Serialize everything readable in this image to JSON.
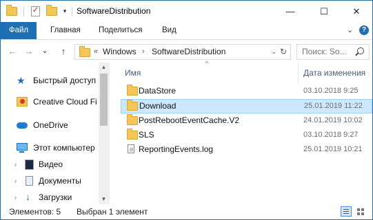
{
  "window": {
    "title": "SoftwareDistribution",
    "quick_access_dropdown": "▾",
    "minimize": "—",
    "maximize": "☐",
    "close": "✕",
    "accent": "#1f6fb5"
  },
  "ribbon": {
    "tabs": [
      "Файл",
      "Главная",
      "Поделиться",
      "Вид"
    ],
    "expand": "⌄",
    "help": "?"
  },
  "nav": {
    "back": "←",
    "forward": "→",
    "recent": "⌄",
    "up": "↑",
    "breadcrumb_overflow": "«",
    "breadcrumb": [
      "Windows",
      "SoftwareDistribution"
    ],
    "breadcrumb_sep": "›",
    "address_dropdown": "⌄",
    "refresh": "↻",
    "search_placeholder": "Поиск: So..."
  },
  "sidebar": {
    "items": [
      {
        "label": "Быстрый доступ",
        "icon": "star-icon"
      },
      {
        "label": "Creative Cloud Files",
        "icon": "creative-cloud-folder-icon"
      },
      {
        "label": "OneDrive",
        "icon": "onedrive-cloud-icon"
      },
      {
        "label": "Этот компьютер",
        "icon": "computer-icon"
      },
      {
        "label": "Видео",
        "icon": "video-icon"
      },
      {
        "label": "Документы",
        "icon": "documents-icon"
      },
      {
        "label": "Загрузки",
        "icon": "downloads-icon"
      }
    ],
    "expander": "›",
    "scroll_up": "▲",
    "scroll_down": "▼"
  },
  "columns": {
    "name": "Имя",
    "date_modified": "Дата изменения",
    "sort_indicator": "^"
  },
  "files": [
    {
      "name": "DataStore",
      "date": "03.10.2018 9:25",
      "type": "folder",
      "selected": false
    },
    {
      "name": "Download",
      "date": "25.01.2019 11:22",
      "type": "folder",
      "selected": true
    },
    {
      "name": "PostRebootEventCache.V2",
      "date": "24.01.2019 10:02",
      "type": "folder",
      "selected": false
    },
    {
      "name": "SLS",
      "date": "03.10.2018 9:27",
      "type": "folder",
      "selected": false
    },
    {
      "name": "ReportingEvents.log",
      "date": "25.01.2019 10:21",
      "type": "file",
      "selected": false
    }
  ],
  "status": {
    "count": "Элементов: 5",
    "selection": "Выбран 1 элемент"
  }
}
